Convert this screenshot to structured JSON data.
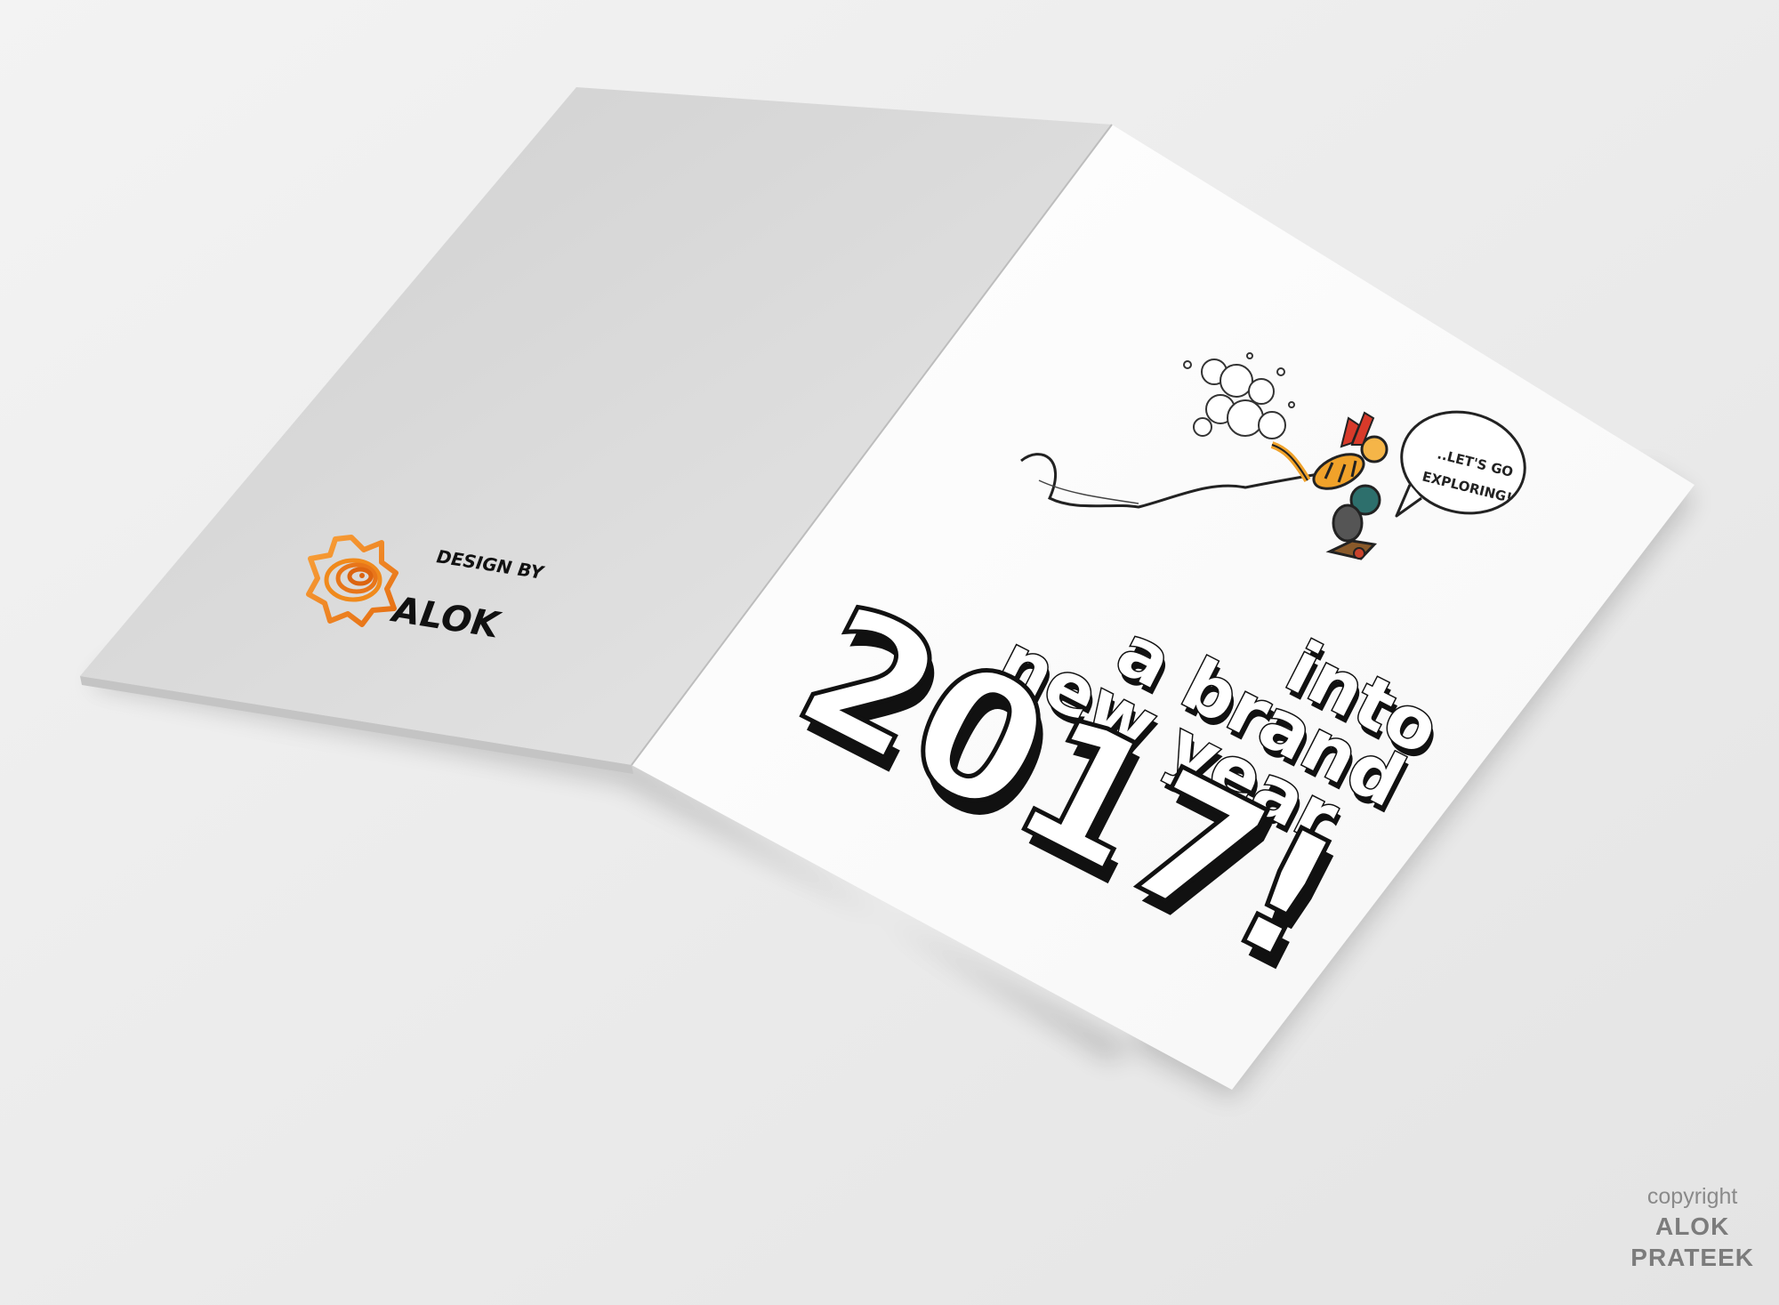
{
  "card": {
    "back_panel": {
      "credit_label": "DESIGN BY",
      "credit_name": "ALOK",
      "logo_icon": "orange-lotus-spiral-logo"
    },
    "front_panel": {
      "speech_bubble": {
        "line1": "..LET'S GO",
        "line2": "EXPLORING!"
      },
      "illustration_icon": "tiger-and-boy-on-sled",
      "headline": {
        "line1": "into",
        "line2": "a brand",
        "line3": "new year",
        "year": "2017!"
      }
    }
  },
  "copyright": {
    "label": "copyright",
    "name_line1": "ALOK",
    "name_line2": "PRATEEK"
  },
  "colors": {
    "background": "#ededed",
    "back_panel": "#d9d9d9",
    "front_panel": "#ffffff",
    "logo_accent": "#f08a1c",
    "ink": "#111111"
  }
}
